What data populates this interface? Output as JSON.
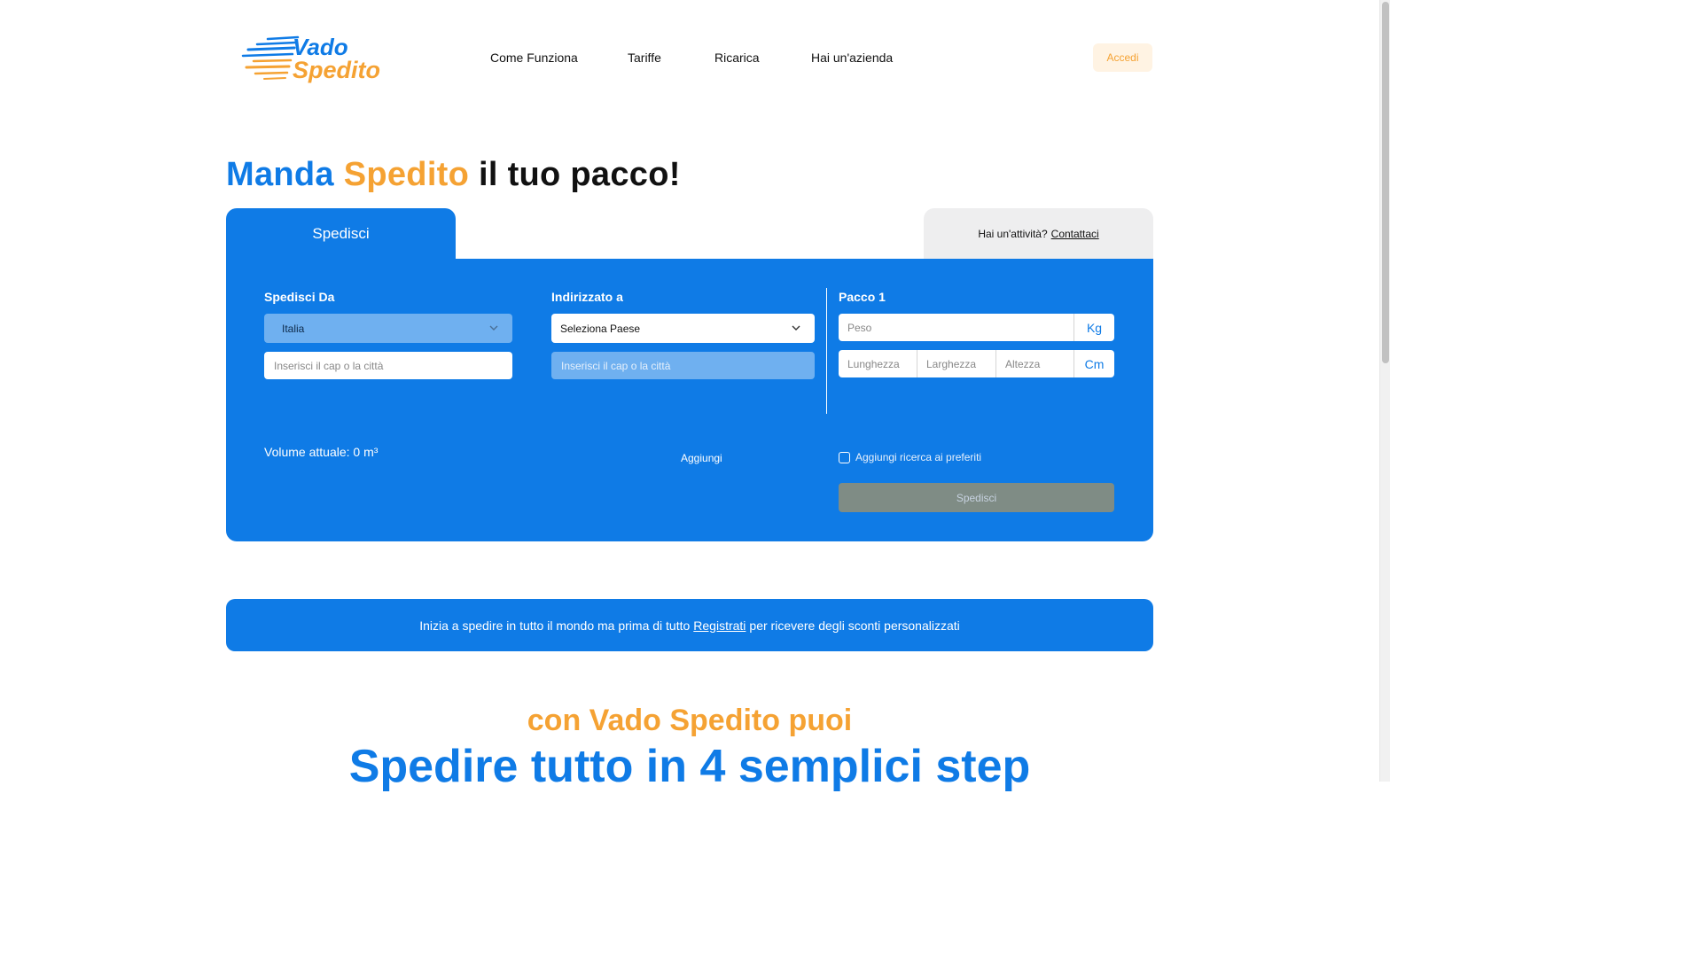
{
  "brand": {
    "logo_line1": "Vado",
    "logo_line2": "Spedito",
    "colors": {
      "blue": "#0f7be6",
      "orange": "#f5a233"
    }
  },
  "nav": {
    "items": [
      "Come Funziona",
      "Tariffe",
      "Ricarica",
      "Hai un'azienda"
    ],
    "login_label": "Accedi"
  },
  "hero": {
    "word1": "Manda",
    "word2": "Spedito",
    "word3": "il tuo pacco!"
  },
  "tabs": {
    "active_label": "Spedisci",
    "business_text": "Hai un'attività?",
    "business_link": "Contattaci"
  },
  "form": {
    "from": {
      "title": "Spedisci Da",
      "country_value": "Italia",
      "city_placeholder": "Inserisci il cap o la città"
    },
    "to": {
      "title": "Indirizzato a",
      "country_value": "Seleziona Paese",
      "city_placeholder": "Inserisci il cap o la città"
    },
    "package": {
      "title": "Pacco 1",
      "weight_placeholder": "Peso",
      "weight_unit": "Kg",
      "length_placeholder": "Lunghezza",
      "width_placeholder": "Larghezza",
      "height_placeholder": "Altezza",
      "dim_unit": "Cm"
    },
    "volume_text": "Volume attuale: 0 m³",
    "add_label": "Aggiungi",
    "favorite_label": "Aggiungi ricerca ai preferiti",
    "submit_label": "Spedisci"
  },
  "banner": {
    "text_before": "Inizia a spedire in tutto il mondo ma prima di tutto",
    "link": "Registrati",
    "text_after": "per ricevere degli sconti personalizzati"
  },
  "section": {
    "sub_heading": "con Vado Spedito puoi",
    "heading": "Spedire tutto in 4 semplici step"
  }
}
